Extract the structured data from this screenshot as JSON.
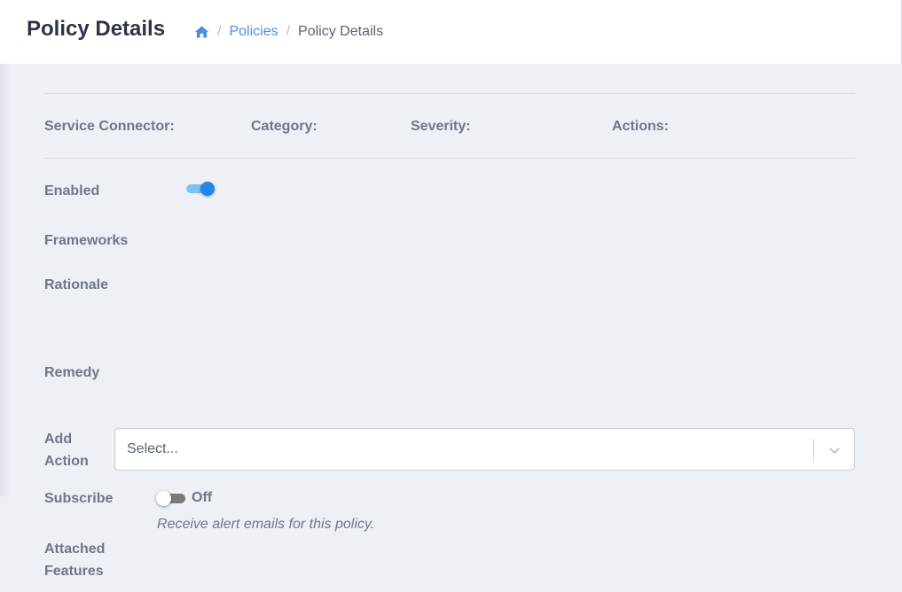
{
  "header": {
    "title": "Policy Details",
    "breadcrumb": {
      "home_icon": "home-icon",
      "separator": "/",
      "items": [
        {
          "label": "Policies"
        },
        {
          "label": "Policy Details"
        }
      ]
    }
  },
  "summary": {
    "service_connector_label": "Service Connector:",
    "category_label": "Category:",
    "severity_label": "Severity:",
    "actions_label": "Actions:"
  },
  "fields": {
    "enabled_label": "Enabled",
    "enabled_value": true,
    "frameworks_label": "Frameworks",
    "rationale_label": "Rationale",
    "remedy_label": "Remedy",
    "add_action_label_line1": "Add",
    "add_action_label_line2": "Action",
    "add_action_placeholder": "Select...",
    "subscribe_label": "Subscribe",
    "subscribe_state": "Off",
    "subscribe_hint": "Receive alert emails for this policy.",
    "attached_features_line1": "Attached",
    "attached_features_line2": "Features"
  },
  "colors": {
    "accent": "#4a90e2",
    "toggle_on": "#1f88e5",
    "toggle_off": "#7a7a7a"
  }
}
